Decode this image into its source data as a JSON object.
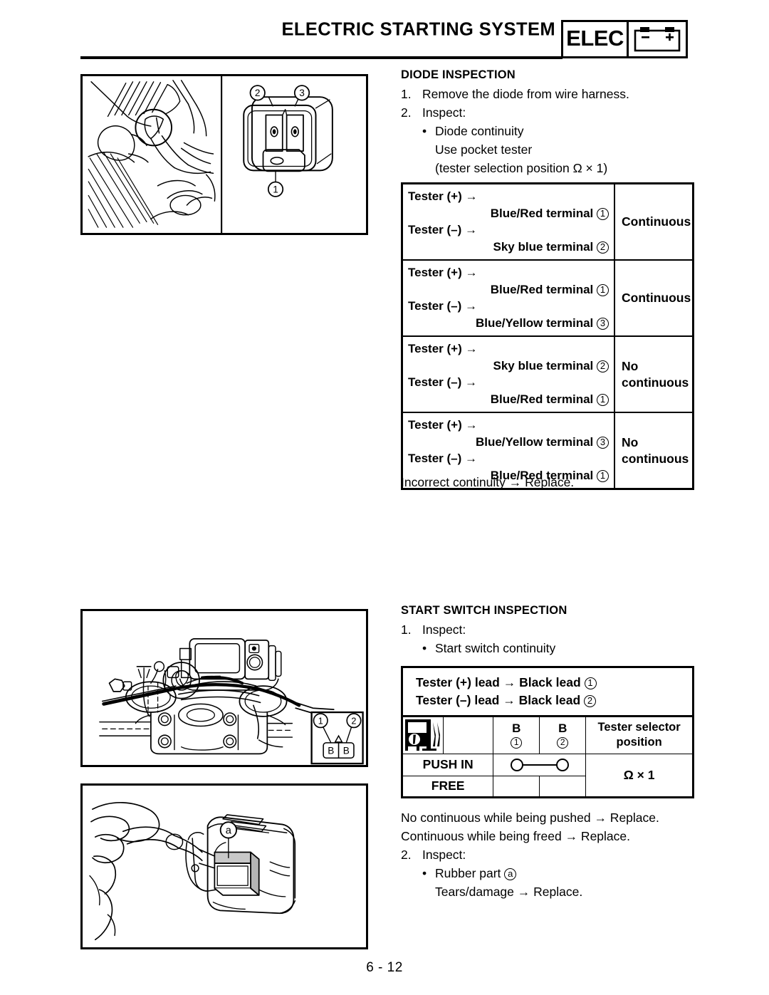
{
  "header": {
    "title": "ELECTRIC STARTING SYSTEM",
    "badge_label": "ELEC",
    "battery_minus": "–",
    "battery_plus": "+"
  },
  "diode_section": {
    "heading": "DIODE INSPECTION",
    "steps": [
      {
        "num": "1.",
        "text": "Remove the diode from wire harness."
      },
      {
        "num": "2.",
        "text": "Inspect:"
      }
    ],
    "bullet": "•",
    "bullet_text": "Diode continuity",
    "sub_line_1": "Use pocket tester",
    "sub_line_2": "(tester selection position Ω × 1)",
    "after_table": "Incorrect continuity → Replace.",
    "table": {
      "rows": [
        {
          "plus_label": "Tester (+) →",
          "plus_terminal": "Blue/Red terminal",
          "plus_num": "1",
          "minus_label": "Tester (–) →",
          "minus_terminal": "Sky blue terminal",
          "minus_num": "2",
          "result": "Continuous"
        },
        {
          "plus_label": "Tester (+) →",
          "plus_terminal": "Blue/Red terminal",
          "plus_num": "1",
          "minus_label": "Tester (–) →",
          "minus_terminal": "Blue/Yellow terminal",
          "minus_num": "3",
          "result": "Continuous"
        },
        {
          "plus_label": "Tester (+) →",
          "plus_terminal": "Sky blue terminal",
          "plus_num": "2",
          "minus_label": "Tester (–) →",
          "minus_terminal": "Blue/Red terminal",
          "minus_num": "1",
          "result": "No\ncontinuous"
        },
        {
          "plus_label": "Tester (+) →",
          "plus_terminal": "Blue/Yellow terminal",
          "plus_num": "3",
          "minus_label": "Tester (–) →",
          "minus_terminal": "Blue/Red terminal",
          "minus_num": "1",
          "result": "No\ncontinuous"
        }
      ]
    }
  },
  "start_switch_section": {
    "heading": "START SWITCH INSPECTION",
    "step1_num": "1.",
    "step1_text": "Inspect:",
    "bullet": "•",
    "bullet_text": "Start switch continuity",
    "lead_line_1": "Tester (+) lead → Black lead",
    "lead_num_1": "1",
    "lead_line_2": "Tester (–) lead → Black lead",
    "lead_num_2": "2",
    "table": {
      "icon_name": "pocket-tester-icon",
      "col_b1_label": "B",
      "col_b1_num": "1",
      "col_b2_label": "B",
      "col_b2_num": "2",
      "selector_header_line1": "Tester selector",
      "selector_header_line2": "position",
      "row_push_label": "PUSH IN",
      "row_free_label": "FREE",
      "selector_value": "Ω × 1"
    },
    "after_lines": [
      "No continuous while being pushed → Replace.",
      "Continuous while being freed → Replace."
    ],
    "step2_num": "2.",
    "step2_text": "Inspect:",
    "bullet2_text": "Rubber part",
    "bullet2_callout": "a",
    "sub_line": "Tears/damage → Replace."
  },
  "figures": {
    "diode": {
      "callout_1": "1",
      "callout_2": "2",
      "callout_3": "3"
    },
    "engine": {
      "callout_1": "1",
      "callout_2": "2",
      "box_b1": "B",
      "box_b2": "B"
    },
    "switch": {
      "callout_a": "a"
    }
  },
  "page_number": "6 - 12"
}
